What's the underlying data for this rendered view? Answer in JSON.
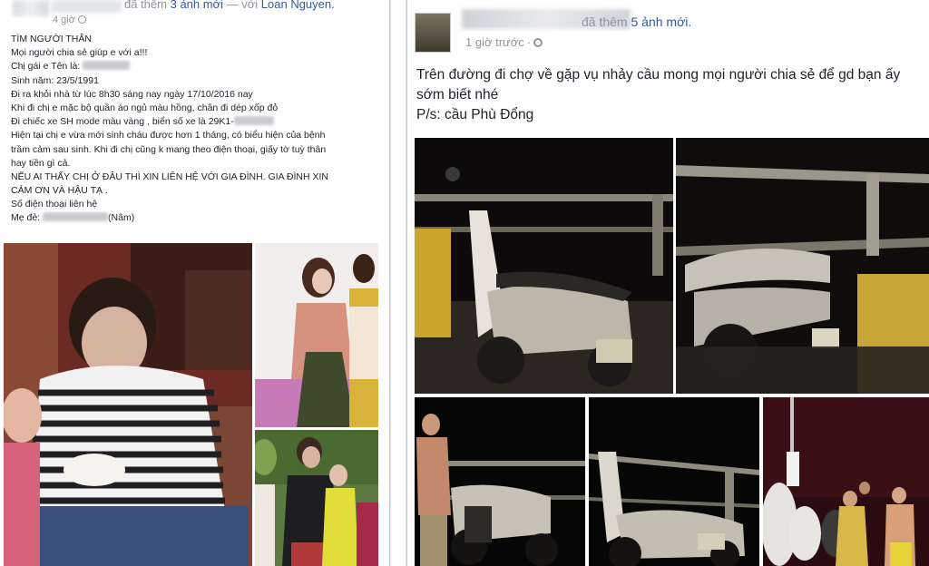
{
  "left_post": {
    "added_text": "đã thêm",
    "added_link": "3 ảnh mới",
    "with_text": "— với",
    "with_name": "Loan Nguyen.",
    "time": "4 giờ",
    "lines": [
      "TÌM NGƯỜI THÂN",
      "Mọi người chia sẻ giúp e với a!!!",
      "Chị gái e Tên là:",
      "Sinh năm: 23/5/1991",
      "Đi ra khỏi nhà từ lúc 8h30 sáng nay ngày 17/10/2016 nay",
      "Khi đi chị e mặc bộ quần áo ngủ màu hồng, chân đi dép xốp đỏ",
      "Đi chiếc xe SH mode màu vàng , biển số xe là 29K1-",
      "Hiện tại chị e vừa mới sinh cháu được hơn 1 tháng, có biểu hiện của bệnh",
      "trầm cảm sau sinh. Khi đi chị cũng k mang theo điện thoại, giấy tờ tuỳ thân",
      "hay tiền gì cả.",
      "NẾU AI THẤY CHỊ Ở ĐÂU THÌ XIN LIÊN HỆ VỚI GIA ĐÌNH. GIA ĐÌNH XIN",
      "CẢM ƠN VÀ HẬU TẠ .",
      "Số điện thoại liên hệ",
      "Mẹ đẻ:"
    ],
    "mother_suffix": "(Nâm)"
  },
  "right_post": {
    "added_text": "đã thêm",
    "added_link": "5 ảnh mới.",
    "time": "1 giờ trước",
    "dot": "·",
    "text_line1": "Trên đường đi chợ về gặp vụ nhảy cầu mong mọi người chia sẻ để gd bạn ấy",
    "text_line2": "sớm biết nhé",
    "text_line3": "P/s: cầu Phù Đổng"
  },
  "colors": {
    "link": "#365899",
    "meta": "#90949c",
    "text": "#1d2129"
  },
  "icons": {
    "privacy": "globe-icon",
    "settings": "gear-icon"
  }
}
